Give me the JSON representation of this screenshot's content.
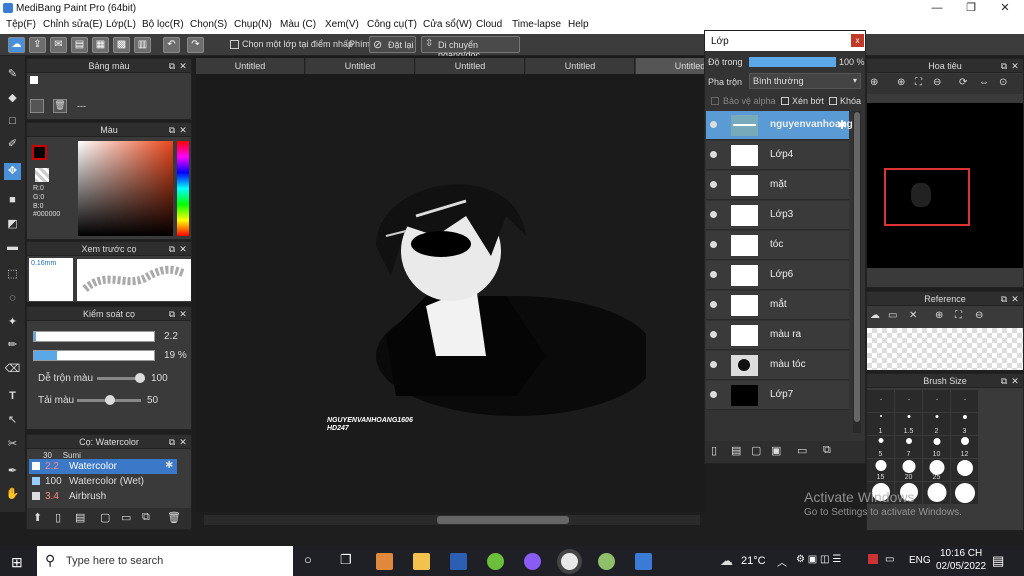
{
  "window": {
    "title": "MediBang Paint Pro (64bit)",
    "minimize": "—",
    "maximize": "❐",
    "close": "✕"
  },
  "menu": [
    "Tệp(F)",
    "Chỉnh sửa(E)",
    "Lớp(L)",
    "Bộ lọc(R)",
    "Chọn(S)",
    "Chụp(N)",
    "Màu (C)",
    "Xem(V)",
    "Công cụ(T)",
    "Cửa sổ(W)",
    "Cloud",
    "Time-lapse",
    "Help"
  ],
  "toolbar": {
    "select_layer_label": "Chọn một lớp tại điểm nhấp",
    "shortcut_label": "Phím",
    "reset_label": "Đặt lại",
    "move_label": "Di chuyển ngang/dọc"
  },
  "panels": {
    "palette": {
      "title": "Bảng màu",
      "name_placeholder": "---"
    },
    "color": {
      "title": "Màu",
      "r": "R:0",
      "g": "G:0",
      "b": "B:0",
      "hex": "#000000"
    },
    "brush_preview": {
      "title": "Xem trước cọ",
      "size": "0.16mm"
    },
    "brush_control": {
      "title": "Kiểm soát cọ",
      "size_value": "2.2",
      "opacity_value": "19 %",
      "blend_label": "Dễ trộn màu",
      "blend_value": "100",
      "reload_label": "Tải màu",
      "reload_value": "50"
    },
    "brushes": {
      "title": "Cọ: Watercolor",
      "items": [
        {
          "size": "30",
          "name": "Sumi"
        },
        {
          "size": "2.2",
          "name": "Watercolor"
        },
        {
          "size": "100",
          "name": "Watercolor (Wet)"
        },
        {
          "size": "3.4",
          "name": "Airbrush"
        }
      ]
    }
  },
  "tabs": [
    "Untitled",
    "Untitled",
    "Untitled",
    "Untitled",
    "Untitled"
  ],
  "canvas": {
    "signature_line1": "NGUYENVANHOANG1606",
    "signature_line2": "HD247"
  },
  "layers": {
    "title": "Lớp",
    "opacity_label": "Độ trong",
    "opacity_value": "100 %",
    "blend_label": "Pha trộn",
    "blend_value": "Bình thường",
    "protect_alpha": "Bảo vệ alpha",
    "clipping": "Xén bớt",
    "lock": "Khóa",
    "items": [
      "nguyenvanhoang",
      "Lớp4",
      "mặt",
      "Lớp3",
      "tóc",
      "Lớp6",
      "mắt",
      "màu ra",
      "màu tóc",
      "Lớp7"
    ]
  },
  "navigator": {
    "title": "Hoa tiêu"
  },
  "reference": {
    "title": "Reference"
  },
  "brush_size": {
    "title": "Brush Size",
    "sizes": [
      "1",
      "1.5",
      "2",
      "3",
      "5",
      "7",
      "10",
      "12",
      "15",
      "20",
      "25"
    ]
  },
  "watermark": {
    "line1": "Activate Windows",
    "line2": "Go to Settings to activate Windows."
  },
  "taskbar": {
    "search_placeholder": "Type here to search",
    "weather": "21°C",
    "lang": "ENG",
    "time": "10:16 CH",
    "date": "02/05/2022"
  },
  "colors": {
    "accent": "#4a90d9",
    "selected_layer": "#5b9bd5",
    "brush_highlight": "#3c78c8"
  }
}
